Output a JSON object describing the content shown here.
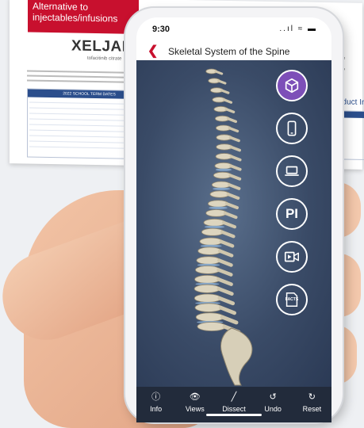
{
  "brochure": {
    "promo_text": "Alternative to\ninjectables/infusions",
    "logo_text": "XELJANZ",
    "logo_sub": "tofacitinib citrate",
    "right_text": "Dear D\nTo acce\nfrom th\nThen fo",
    "right_heading": "Product Info",
    "table_title": "2022 SCHOOL TERM DATES"
  },
  "phone": {
    "status": {
      "time": "9:30",
      "icons": "..ıl ≈ ▬"
    },
    "title": "Skeletal System of the Spine",
    "side_buttons": [
      {
        "name": "3d-model",
        "icon": "cube-icon",
        "active": true
      },
      {
        "name": "phone-view",
        "icon": "phone-icon",
        "active": false
      },
      {
        "name": "laptop-view",
        "icon": "laptop-icon",
        "active": false
      },
      {
        "name": "product-info",
        "icon": "pi-icon",
        "label": "PI",
        "active": false
      },
      {
        "name": "video",
        "icon": "video-icon",
        "active": false
      },
      {
        "name": "facts",
        "icon": "facts-icon",
        "label": "FACTS",
        "active": false
      }
    ],
    "toolbar": {
      "info": "Info",
      "views": "Views",
      "dissect": "Dissect",
      "undo": "Undo",
      "reset": "Reset"
    }
  },
  "colors": {
    "accent": "#c8102e",
    "active_button": "#7d4fb8",
    "viewer_bg": "#3a4b67",
    "toolbar_bg": "#222b3b"
  }
}
